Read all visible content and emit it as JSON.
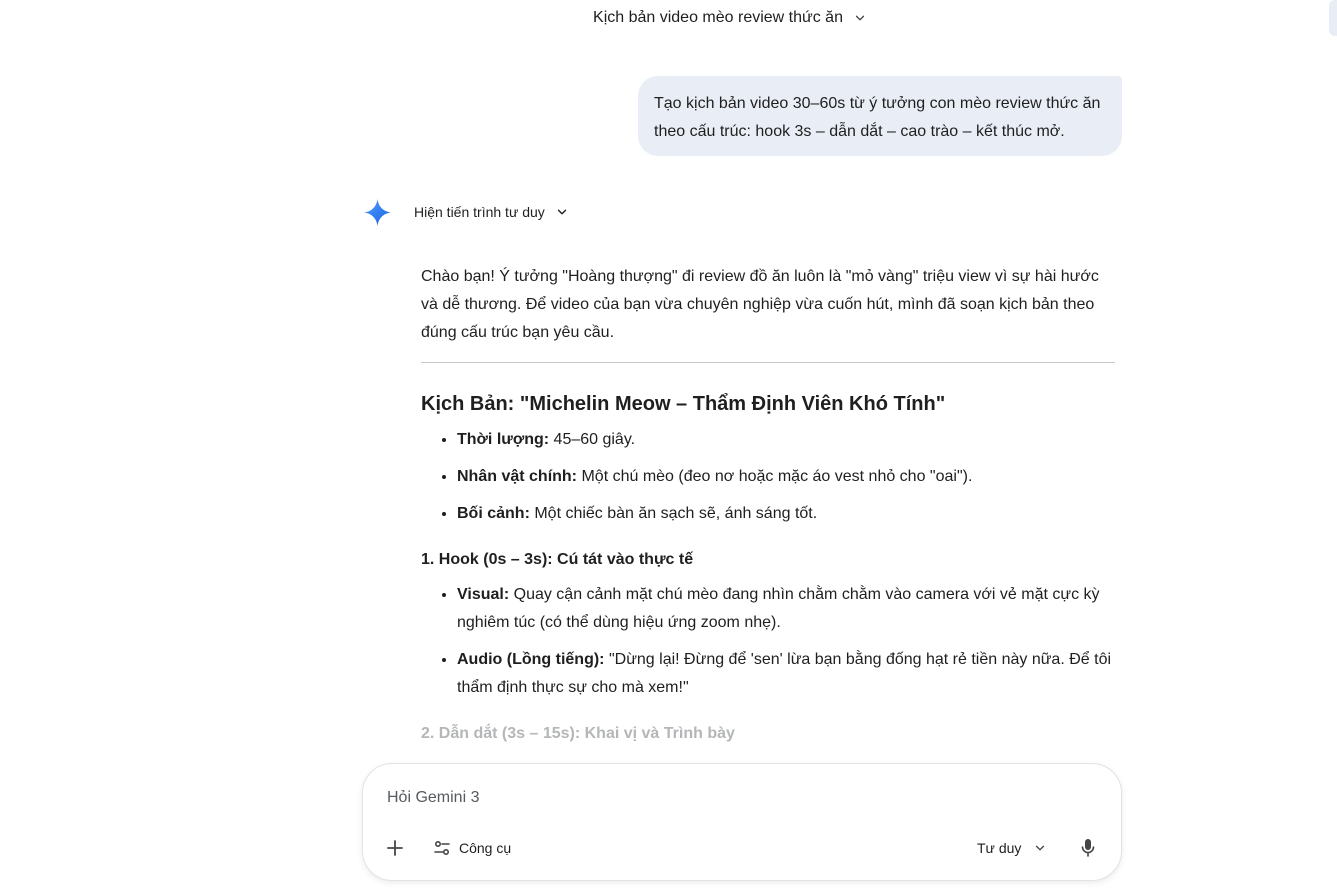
{
  "header": {
    "chat_title": "Kịch bản video mèo review thức ăn"
  },
  "user_message": {
    "text": "Tạo kịch bản video 30–60s từ ý tưởng con mèo review thức ăn theo cấu trúc: hook 3s – dẫn dắt – cao trào – kết thúc mở."
  },
  "response": {
    "thinking_label": "Hiện tiến trình tư duy",
    "intro": "Chào bạn! Ý tưởng \"Hoàng thượng\" đi review đồ ăn luôn là \"mỏ vàng\" triệu view vì sự hài hước và dễ thương. Để video của bạn vừa chuyên nghiệp vừa cuốn hút, mình đã soạn kịch bản theo đúng cấu trúc bạn yêu cầu.",
    "script_title": "Kịch Bản: \"Michelin Meow – Thẩm Định Viên Khó Tính\"",
    "details": [
      {
        "label": "Thời lượng:",
        "text": " 45–60 giây."
      },
      {
        "label": "Nhân vật chính:",
        "text": " Một chú mèo (đeo nơ hoặc mặc áo vest nhỏ cho \"oai\")."
      },
      {
        "label": "Bối cảnh:",
        "text": " Một chiếc bàn ăn sạch sẽ, ánh sáng tốt."
      }
    ],
    "section1": {
      "heading": "1. Hook (0s – 3s): Cú tát vào thực tế",
      "items": [
        {
          "label": "Visual:",
          "text": " Quay cận cảnh mặt chú mèo đang nhìn chằm chằm vào camera với vẻ mặt cực kỳ nghiêm túc (có thể dùng hiệu ứng zoom nhẹ)."
        },
        {
          "label": "Audio (Lồng tiếng):",
          "text": " \"Dừng lại! Đừng để 'sen' lừa bạn bằng đống hạt rẻ tiền này nữa. Để tôi thẩm định thực sự cho mà xem!\""
        }
      ]
    },
    "section2": {
      "heading": "2. Dẫn dắt (3s – 15s): Khai vị và Trình bày"
    }
  },
  "composer": {
    "placeholder": "Hỏi Gemini 3",
    "tools_label": "Công cụ",
    "mode_label": "Tư duy"
  },
  "icons": {
    "chat_title_chevron": "chevron-down-icon",
    "gemini": "gemini-sparkle-icon",
    "plus": "plus-icon",
    "tools": "tune-icon",
    "mode_chevron": "chevron-down-icon",
    "mic": "microphone-icon"
  },
  "colors": {
    "user_bubble_bg": "#e9eef6",
    "gemini_blue": "#4285f4",
    "faded_text": "#b4b6b8"
  }
}
